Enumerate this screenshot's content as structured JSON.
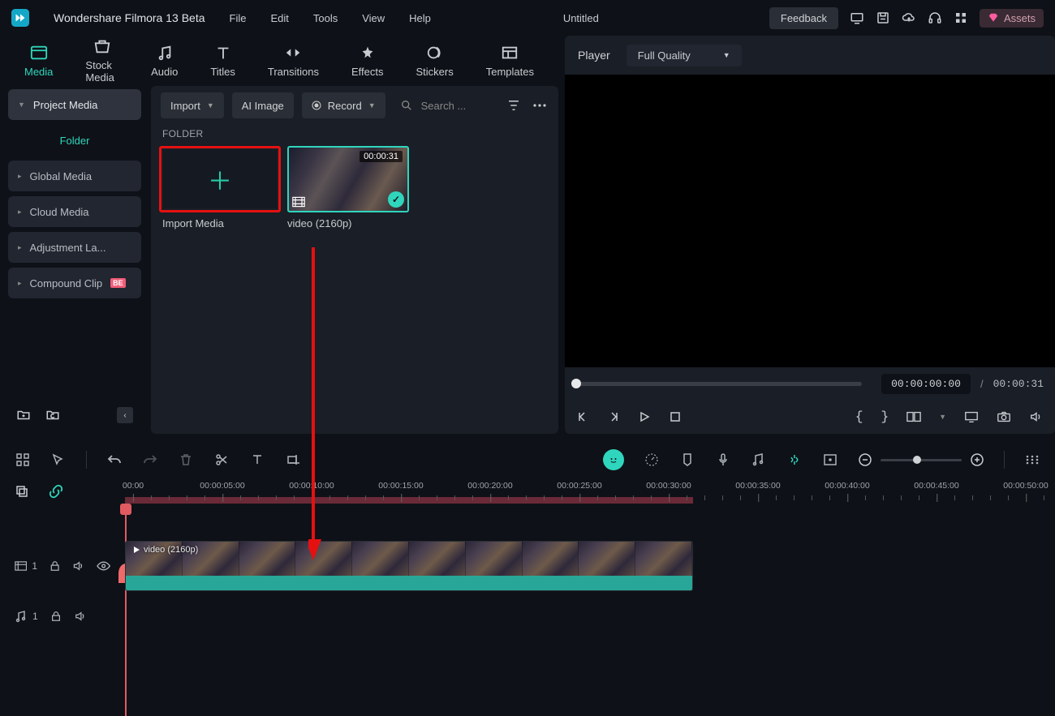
{
  "app": {
    "title": "Wondershare Filmora 13 Beta",
    "document": "Untitled"
  },
  "menu": {
    "file": "File",
    "edit": "Edit",
    "tools": "Tools",
    "view": "View",
    "help": "Help"
  },
  "menubar_right": {
    "feedback": "Feedback",
    "assets": "Assets"
  },
  "tabs": {
    "media": "Media",
    "stock_media": "Stock Media",
    "audio": "Audio",
    "titles": "Titles",
    "transitions": "Transitions",
    "effects": "Effects",
    "stickers": "Stickers",
    "templates": "Templates",
    "active": "media"
  },
  "sidebar": {
    "project_media": "Project Media",
    "folder": "Folder",
    "items": [
      {
        "label": "Global Media"
      },
      {
        "label": "Cloud Media"
      },
      {
        "label": "Adjustment La..."
      },
      {
        "label": "Compound Clip",
        "badge": "BE"
      }
    ]
  },
  "media_toolbar": {
    "import": "Import",
    "ai_image": "AI Image",
    "record": "Record",
    "search_placeholder": "Search ..."
  },
  "media_area": {
    "section": "FOLDER",
    "import_media": "Import Media",
    "clip": {
      "name": "video (2160p)",
      "duration": "00:00:31"
    }
  },
  "preview": {
    "player_label": "Player",
    "quality": "Full Quality",
    "current": "00:00:00:00",
    "total": "00:00:31"
  },
  "timeline": {
    "ticks": [
      "00:00",
      "00:00:05:00",
      "00:00:10:00",
      "00:00:15:00",
      "00:00:20:00",
      "00:00:25:00",
      "00:00:30:00",
      "00:00:35:00",
      "00:00:40:00",
      "00:00:45:00",
      "00:00:50:00"
    ],
    "clip_label": "video (2160p)",
    "video_track": "1",
    "audio_track": "1"
  }
}
